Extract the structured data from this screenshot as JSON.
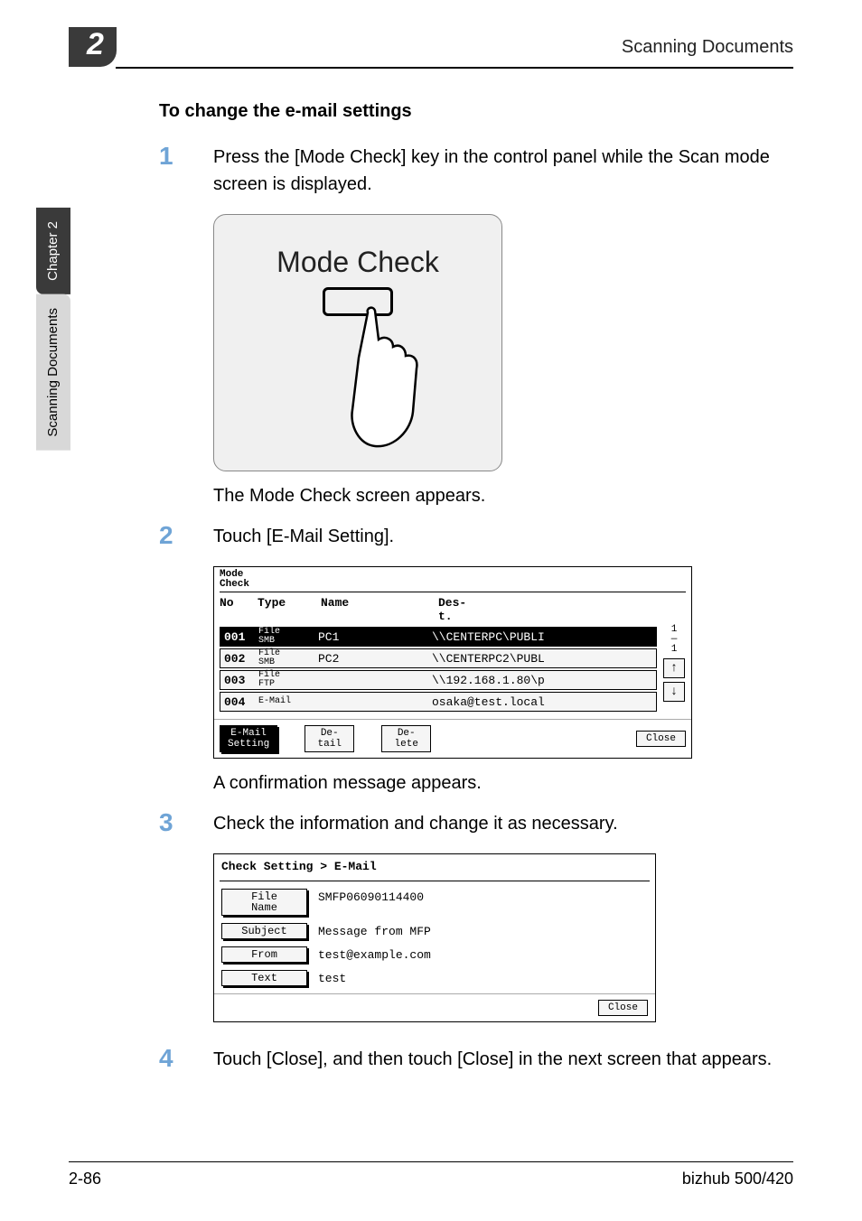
{
  "header": {
    "chapter_badge": "2",
    "title": "Scanning Documents"
  },
  "sidebar": {
    "chapter_tab": "Chapter 2",
    "section_tab": "Scanning Documents"
  },
  "section": {
    "heading": "To change the e-mail settings"
  },
  "steps": {
    "s1": {
      "num": "1",
      "text": "Press the [Mode Check] key in the control panel while the Scan mode screen is displayed."
    },
    "s2": {
      "num": "2",
      "text": "Touch [E-Mail Setting]."
    },
    "s3": {
      "num": "3",
      "text": "Check the information and change it as necessary."
    },
    "s4": {
      "num": "4",
      "text": "Touch [Close], and then touch [Close] in the next screen that appears."
    }
  },
  "modecheck": {
    "label": "Mode Check"
  },
  "post_step1": "The Mode Check screen appears.",
  "post_step2": "A confirmation message appears.",
  "lcd1": {
    "title_line1": "Mode",
    "title_line2": "Check",
    "col_no": "No",
    "col_type": "Type",
    "col_name": "Name",
    "col_dest_line1": "Des-",
    "col_dest_line2": "t.",
    "page_indicator": "1\n—\n1",
    "rows": [
      {
        "no": "001",
        "type_l1": "File",
        "type_l2": "SMB",
        "name": "PC1",
        "dest": "\\\\CENTERPC\\PUBLI",
        "selected": true
      },
      {
        "no": "002",
        "type_l1": "File",
        "type_l2": "SMB",
        "name": "PC2",
        "dest": "\\\\CENTERPC2\\PUBL",
        "selected": false
      },
      {
        "no": "003",
        "type_l1": "File",
        "type_l2": "FTP",
        "name": "",
        "dest": "\\\\192.168.1.80\\p",
        "selected": false
      },
      {
        "no": "004",
        "type_l1": "E-Mail",
        "type_l2": "",
        "name": "",
        "dest": "osaka@test.local",
        "selected": false
      }
    ],
    "btn_email_l1": "E-Mail",
    "btn_email_l2": "Setting",
    "btn_detail_l1": "De-",
    "btn_detail_l2": "tail",
    "btn_delete_l1": "De-",
    "btn_delete_l2": "lete",
    "btn_close": "Close",
    "arrow_up": "↑",
    "arrow_down": "↓"
  },
  "lcd2": {
    "breadcrumb": "Check Setting > E-Mail",
    "rows": [
      {
        "label_l1": "File",
        "label_l2": "Name",
        "value": "SMFP06090114400"
      },
      {
        "label_l1": "Subject",
        "label_l2": "",
        "value": "Message from MFP"
      },
      {
        "label_l1": "From",
        "label_l2": "",
        "value": "test@example.com"
      },
      {
        "label_l1": "Text",
        "label_l2": "",
        "value": "test"
      }
    ],
    "btn_close": "Close"
  },
  "footer": {
    "page": "2-86",
    "model": "bizhub 500/420"
  }
}
